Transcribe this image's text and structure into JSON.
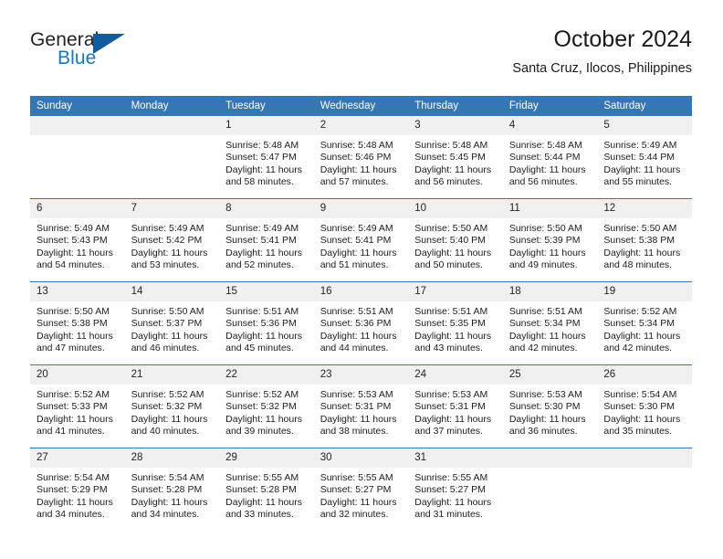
{
  "brand": {
    "name_part1": "General",
    "name_part2": "Blue",
    "accent_color": "#1878be",
    "triangle_color": "#0f5d9e"
  },
  "header": {
    "title": "October 2024",
    "location": "Santa Cruz, Ilocos, Philippines"
  },
  "theme": {
    "header_blue": "#3576b5",
    "daynum_background": "#f0f0f0"
  },
  "weekday_headers": [
    "Sunday",
    "Monday",
    "Tuesday",
    "Wednesday",
    "Thursday",
    "Friday",
    "Saturday"
  ],
  "weeks": [
    [
      {
        "day": "",
        "sunrise": "",
        "sunset": "",
        "daylight1": "",
        "daylight2": "",
        "blank": true
      },
      {
        "day": "",
        "sunrise": "",
        "sunset": "",
        "daylight1": "",
        "daylight2": "",
        "blank": true
      },
      {
        "day": "1",
        "sunrise": "Sunrise: 5:48 AM",
        "sunset": "Sunset: 5:47 PM",
        "daylight1": "Daylight: 11 hours",
        "daylight2": "and 58 minutes."
      },
      {
        "day": "2",
        "sunrise": "Sunrise: 5:48 AM",
        "sunset": "Sunset: 5:46 PM",
        "daylight1": "Daylight: 11 hours",
        "daylight2": "and 57 minutes."
      },
      {
        "day": "3",
        "sunrise": "Sunrise: 5:48 AM",
        "sunset": "Sunset: 5:45 PM",
        "daylight1": "Daylight: 11 hours",
        "daylight2": "and 56 minutes."
      },
      {
        "day": "4",
        "sunrise": "Sunrise: 5:48 AM",
        "sunset": "Sunset: 5:44 PM",
        "daylight1": "Daylight: 11 hours",
        "daylight2": "and 56 minutes."
      },
      {
        "day": "5",
        "sunrise": "Sunrise: 5:49 AM",
        "sunset": "Sunset: 5:44 PM",
        "daylight1": "Daylight: 11 hours",
        "daylight2": "and 55 minutes."
      }
    ],
    [
      {
        "day": "6",
        "sunrise": "Sunrise: 5:49 AM",
        "sunset": "Sunset: 5:43 PM",
        "daylight1": "Daylight: 11 hours",
        "daylight2": "and 54 minutes."
      },
      {
        "day": "7",
        "sunrise": "Sunrise: 5:49 AM",
        "sunset": "Sunset: 5:42 PM",
        "daylight1": "Daylight: 11 hours",
        "daylight2": "and 53 minutes."
      },
      {
        "day": "8",
        "sunrise": "Sunrise: 5:49 AM",
        "sunset": "Sunset: 5:41 PM",
        "daylight1": "Daylight: 11 hours",
        "daylight2": "and 52 minutes."
      },
      {
        "day": "9",
        "sunrise": "Sunrise: 5:49 AM",
        "sunset": "Sunset: 5:41 PM",
        "daylight1": "Daylight: 11 hours",
        "daylight2": "and 51 minutes."
      },
      {
        "day": "10",
        "sunrise": "Sunrise: 5:50 AM",
        "sunset": "Sunset: 5:40 PM",
        "daylight1": "Daylight: 11 hours",
        "daylight2": "and 50 minutes."
      },
      {
        "day": "11",
        "sunrise": "Sunrise: 5:50 AM",
        "sunset": "Sunset: 5:39 PM",
        "daylight1": "Daylight: 11 hours",
        "daylight2": "and 49 minutes."
      },
      {
        "day": "12",
        "sunrise": "Sunrise: 5:50 AM",
        "sunset": "Sunset: 5:38 PM",
        "daylight1": "Daylight: 11 hours",
        "daylight2": "and 48 minutes."
      }
    ],
    [
      {
        "day": "13",
        "sunrise": "Sunrise: 5:50 AM",
        "sunset": "Sunset: 5:38 PM",
        "daylight1": "Daylight: 11 hours",
        "daylight2": "and 47 minutes."
      },
      {
        "day": "14",
        "sunrise": "Sunrise: 5:50 AM",
        "sunset": "Sunset: 5:37 PM",
        "daylight1": "Daylight: 11 hours",
        "daylight2": "and 46 minutes."
      },
      {
        "day": "15",
        "sunrise": "Sunrise: 5:51 AM",
        "sunset": "Sunset: 5:36 PM",
        "daylight1": "Daylight: 11 hours",
        "daylight2": "and 45 minutes."
      },
      {
        "day": "16",
        "sunrise": "Sunrise: 5:51 AM",
        "sunset": "Sunset: 5:36 PM",
        "daylight1": "Daylight: 11 hours",
        "daylight2": "and 44 minutes."
      },
      {
        "day": "17",
        "sunrise": "Sunrise: 5:51 AM",
        "sunset": "Sunset: 5:35 PM",
        "daylight1": "Daylight: 11 hours",
        "daylight2": "and 43 minutes."
      },
      {
        "day": "18",
        "sunrise": "Sunrise: 5:51 AM",
        "sunset": "Sunset: 5:34 PM",
        "daylight1": "Daylight: 11 hours",
        "daylight2": "and 42 minutes."
      },
      {
        "day": "19",
        "sunrise": "Sunrise: 5:52 AM",
        "sunset": "Sunset: 5:34 PM",
        "daylight1": "Daylight: 11 hours",
        "daylight2": "and 42 minutes."
      }
    ],
    [
      {
        "day": "20",
        "sunrise": "Sunrise: 5:52 AM",
        "sunset": "Sunset: 5:33 PM",
        "daylight1": "Daylight: 11 hours",
        "daylight2": "and 41 minutes."
      },
      {
        "day": "21",
        "sunrise": "Sunrise: 5:52 AM",
        "sunset": "Sunset: 5:32 PM",
        "daylight1": "Daylight: 11 hours",
        "daylight2": "and 40 minutes."
      },
      {
        "day": "22",
        "sunrise": "Sunrise: 5:52 AM",
        "sunset": "Sunset: 5:32 PM",
        "daylight1": "Daylight: 11 hours",
        "daylight2": "and 39 minutes."
      },
      {
        "day": "23",
        "sunrise": "Sunrise: 5:53 AM",
        "sunset": "Sunset: 5:31 PM",
        "daylight1": "Daylight: 11 hours",
        "daylight2": "and 38 minutes."
      },
      {
        "day": "24",
        "sunrise": "Sunrise: 5:53 AM",
        "sunset": "Sunset: 5:31 PM",
        "daylight1": "Daylight: 11 hours",
        "daylight2": "and 37 minutes."
      },
      {
        "day": "25",
        "sunrise": "Sunrise: 5:53 AM",
        "sunset": "Sunset: 5:30 PM",
        "daylight1": "Daylight: 11 hours",
        "daylight2": "and 36 minutes."
      },
      {
        "day": "26",
        "sunrise": "Sunrise: 5:54 AM",
        "sunset": "Sunset: 5:30 PM",
        "daylight1": "Daylight: 11 hours",
        "daylight2": "and 35 minutes."
      }
    ],
    [
      {
        "day": "27",
        "sunrise": "Sunrise: 5:54 AM",
        "sunset": "Sunset: 5:29 PM",
        "daylight1": "Daylight: 11 hours",
        "daylight2": "and 34 minutes."
      },
      {
        "day": "28",
        "sunrise": "Sunrise: 5:54 AM",
        "sunset": "Sunset: 5:28 PM",
        "daylight1": "Daylight: 11 hours",
        "daylight2": "and 34 minutes."
      },
      {
        "day": "29",
        "sunrise": "Sunrise: 5:55 AM",
        "sunset": "Sunset: 5:28 PM",
        "daylight1": "Daylight: 11 hours",
        "daylight2": "and 33 minutes."
      },
      {
        "day": "30",
        "sunrise": "Sunrise: 5:55 AM",
        "sunset": "Sunset: 5:27 PM",
        "daylight1": "Daylight: 11 hours",
        "daylight2": "and 32 minutes."
      },
      {
        "day": "31",
        "sunrise": "Sunrise: 5:55 AM",
        "sunset": "Sunset: 5:27 PM",
        "daylight1": "Daylight: 11 hours",
        "daylight2": "and 31 minutes."
      },
      {
        "day": "",
        "sunrise": "",
        "sunset": "",
        "daylight1": "",
        "daylight2": "",
        "blank": true
      },
      {
        "day": "",
        "sunrise": "",
        "sunset": "",
        "daylight1": "",
        "daylight2": "",
        "blank": true
      }
    ]
  ]
}
